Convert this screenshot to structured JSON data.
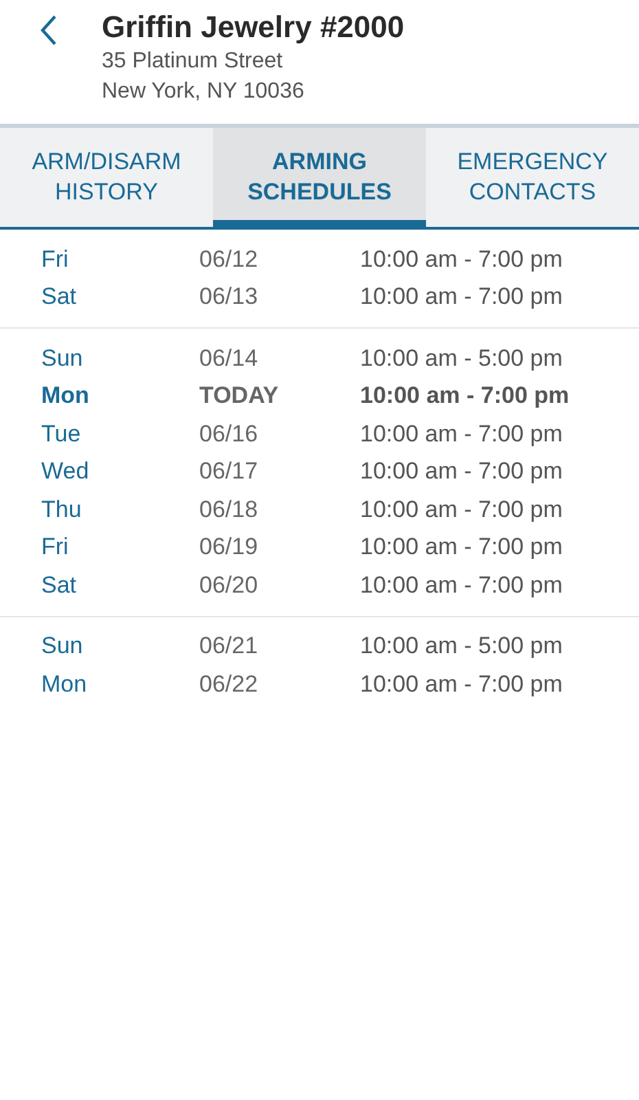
{
  "header": {
    "title": "Griffin Jewelry #2000",
    "address_lines": [
      "35 Platinum Street",
      "New York, NY 10036"
    ]
  },
  "tabs": [
    {
      "label": "ARM/DISARM\nHISTORY",
      "selected": false
    },
    {
      "label": "ARMING\nSCHEDULES",
      "selected": true
    },
    {
      "label": "EMERGENCY\nCONTACTS",
      "selected": false
    }
  ],
  "weeks": [
    {
      "days": [
        {
          "day": "Fri",
          "date": "06/12",
          "hours": "10:00 am - 7:00 pm",
          "today": false
        },
        {
          "day": "Sat",
          "date": "06/13",
          "hours": "10:00 am - 7:00 pm",
          "today": false
        }
      ]
    },
    {
      "days": [
        {
          "day": "Sun",
          "date": "06/14",
          "hours": "10:00 am - 5:00 pm",
          "today": false
        },
        {
          "day": "Mon",
          "date": "TODAY",
          "hours": "10:00 am - 7:00 pm",
          "today": true
        },
        {
          "day": "Tue",
          "date": "06/16",
          "hours": "10:00 am - 7:00 pm",
          "today": false
        },
        {
          "day": "Wed",
          "date": "06/17",
          "hours": "10:00 am - 7:00 pm",
          "today": false
        },
        {
          "day": "Thu",
          "date": "06/18",
          "hours": "10:00 am - 7:00 pm",
          "today": false
        },
        {
          "day": "Fri",
          "date": "06/19",
          "hours": "10:00 am - 7:00 pm",
          "today": false
        },
        {
          "day": "Sat",
          "date": "06/20",
          "hours": "10:00 am - 7:00 pm",
          "today": false
        }
      ]
    },
    {
      "days": [
        {
          "day": "Sun",
          "date": "06/21",
          "hours": "10:00 am - 5:00 pm",
          "today": false
        },
        {
          "day": "Mon",
          "date": "06/22",
          "hours": "10:00 am - 7:00 pm",
          "today": false
        }
      ]
    }
  ]
}
